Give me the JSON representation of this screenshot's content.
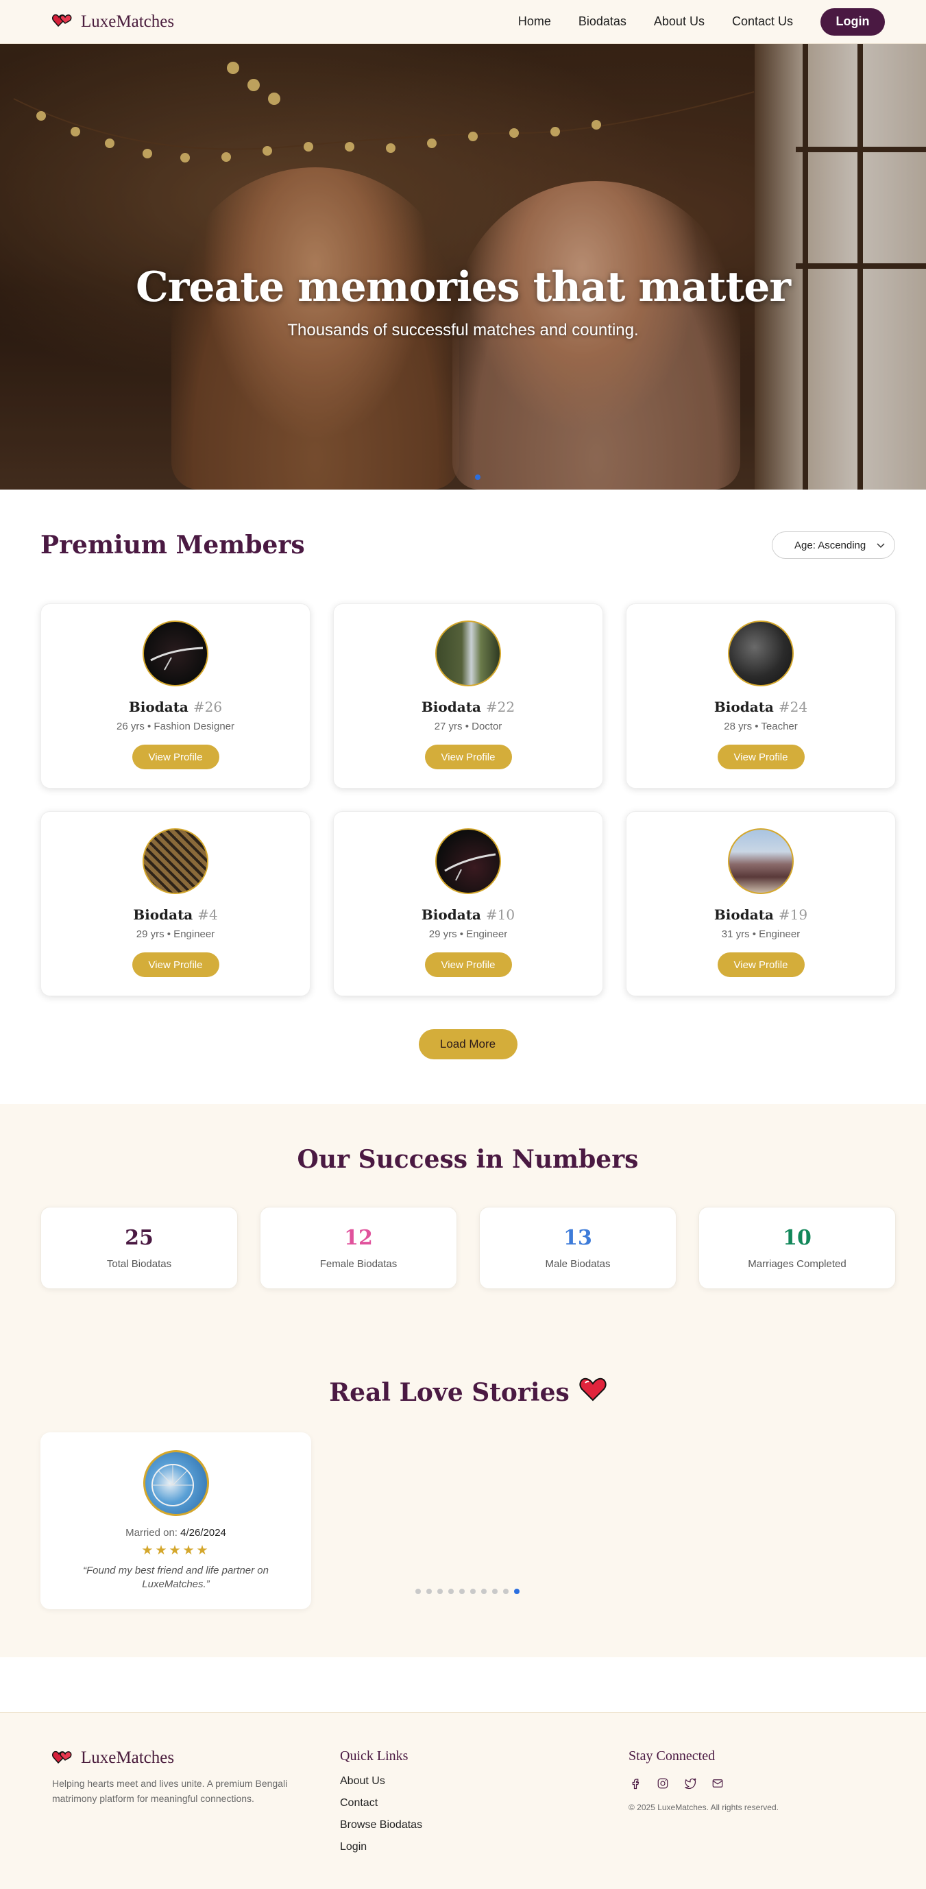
{
  "nav": {
    "brand": "LuxeMatches",
    "links": [
      "Home",
      "Biodatas",
      "About Us",
      "Contact Us"
    ],
    "login": "Login"
  },
  "hero": {
    "title": "Create memories that matter",
    "subtitle": "Thousands of successful matches and counting."
  },
  "premium": {
    "title": "Premium Members",
    "sort": "Age: Ascending",
    "cards": [
      {
        "name": "Biodata",
        "num": "#26",
        "meta": "26 yrs • Fashion Designer",
        "button": "View Profile"
      },
      {
        "name": "Biodata",
        "num": "#22",
        "meta": "27 yrs • Doctor",
        "button": "View Profile"
      },
      {
        "name": "Biodata",
        "num": "#24",
        "meta": "28 yrs • Teacher",
        "button": "View Profile"
      },
      {
        "name": "Biodata",
        "num": "#4",
        "meta": "29 yrs • Engineer",
        "button": "View Profile"
      },
      {
        "name": "Biodata",
        "num": "#10",
        "meta": "29 yrs • Engineer",
        "button": "View Profile"
      },
      {
        "name": "Biodata",
        "num": "#19",
        "meta": "31 yrs • Engineer",
        "button": "View Profile"
      }
    ],
    "load_more": "Load More"
  },
  "stats": {
    "title": "Our Success in Numbers",
    "items": [
      {
        "value": "25",
        "label": "Total Biodatas",
        "color": "#4a1942"
      },
      {
        "value": "12",
        "label": "Female Biodatas",
        "color": "#e0529c"
      },
      {
        "value": "13",
        "label": "Male Biodatas",
        "color": "#3d7bd9"
      },
      {
        "value": "10",
        "label": "Marriages Completed",
        "color": "#12875a"
      }
    ]
  },
  "stories": {
    "title": "Real Love Stories",
    "married_label": "Married on:",
    "married_date": "4/26/2024",
    "rating": 5,
    "stars": "★★★★★",
    "quote": "“Found my best friend and life partner on LuxeMatches.”",
    "slides": 10,
    "active_slide": 9
  },
  "footer": {
    "brand": "LuxeMatches",
    "description": "Helping hearts meet and lives unite. A premium Bengali matrimony platform for meaningful connections.",
    "quick_links_title": "Quick Links",
    "quick_links": [
      "About Us",
      "Contact",
      "Browse Biodatas",
      "Login"
    ],
    "connect_title": "Stay Connected",
    "copyright": "© 2025 LuxeMatches. All rights reserved."
  },
  "icons": {
    "logo": "hearts-logo-icon",
    "sort": "chevron-down-icon",
    "heart": "heart-icon",
    "social": [
      "facebook-icon",
      "instagram-icon",
      "twitter-icon",
      "mail-icon"
    ]
  },
  "colors": {
    "primary": "#4a1942",
    "accent": "#d4ad3a",
    "cream": "#fcf7ef"
  }
}
